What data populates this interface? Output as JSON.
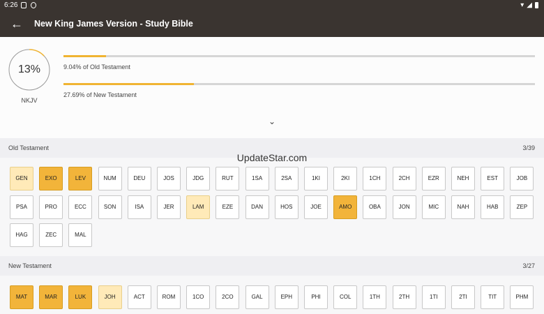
{
  "status_bar": {
    "time": "6:26"
  },
  "app_bar": {
    "title": "New King James Version - Study Bible"
  },
  "progress": {
    "overall_percent": "13%",
    "overall_fraction": 0.13,
    "version_label": "NKJV",
    "old_testament": {
      "caption": "9.04% of Old Testament",
      "fraction": 0.0904
    },
    "new_testament": {
      "caption": "27.69% of New Testament",
      "fraction": 0.2769
    }
  },
  "watermark": "UpdateStar.com",
  "old_testament": {
    "name": "Old Testament",
    "count": "3/39",
    "books": [
      {
        "code": "GEN",
        "status": "partial"
      },
      {
        "code": "EXO",
        "status": "done"
      },
      {
        "code": "LEV",
        "status": "done"
      },
      {
        "code": "NUM",
        "status": "none"
      },
      {
        "code": "DEU",
        "status": "none"
      },
      {
        "code": "JOS",
        "status": "none"
      },
      {
        "code": "JDG",
        "status": "none"
      },
      {
        "code": "RUT",
        "status": "none"
      },
      {
        "code": "1SA",
        "status": "none"
      },
      {
        "code": "2SA",
        "status": "none"
      },
      {
        "code": "1KI",
        "status": "none"
      },
      {
        "code": "2KI",
        "status": "none"
      },
      {
        "code": "1CH",
        "status": "none"
      },
      {
        "code": "2CH",
        "status": "none"
      },
      {
        "code": "EZR",
        "status": "none"
      },
      {
        "code": "NEH",
        "status": "none"
      },
      {
        "code": "EST",
        "status": "none"
      },
      {
        "code": "JOB",
        "status": "none"
      },
      {
        "code": "PSA",
        "status": "none"
      },
      {
        "code": "PRO",
        "status": "none"
      },
      {
        "code": "ECC",
        "status": "none"
      },
      {
        "code": "SON",
        "status": "none"
      },
      {
        "code": "ISA",
        "status": "none"
      },
      {
        "code": "JER",
        "status": "none"
      },
      {
        "code": "LAM",
        "status": "partial"
      },
      {
        "code": "EZE",
        "status": "none"
      },
      {
        "code": "DAN",
        "status": "none"
      },
      {
        "code": "HOS",
        "status": "none"
      },
      {
        "code": "JOE",
        "status": "none"
      },
      {
        "code": "AMO",
        "status": "done"
      },
      {
        "code": "OBA",
        "status": "none"
      },
      {
        "code": "JON",
        "status": "none"
      },
      {
        "code": "MIC",
        "status": "none"
      },
      {
        "code": "NAH",
        "status": "none"
      },
      {
        "code": "HAB",
        "status": "none"
      },
      {
        "code": "ZEP",
        "status": "none"
      },
      {
        "code": "HAG",
        "status": "none"
      },
      {
        "code": "ZEC",
        "status": "none"
      },
      {
        "code": "MAL",
        "status": "none"
      }
    ]
  },
  "new_testament": {
    "name": "New Testament",
    "count": "3/27",
    "books": [
      {
        "code": "MAT",
        "status": "done"
      },
      {
        "code": "MAR",
        "status": "done"
      },
      {
        "code": "LUK",
        "status": "done"
      },
      {
        "code": "JOH",
        "status": "partial"
      },
      {
        "code": "ACT",
        "status": "none"
      },
      {
        "code": "ROM",
        "status": "none"
      },
      {
        "code": "1CO",
        "status": "none"
      },
      {
        "code": "2CO",
        "status": "none"
      },
      {
        "code": "GAL",
        "status": "none"
      },
      {
        "code": "EPH",
        "status": "none"
      },
      {
        "code": "PHI",
        "status": "none"
      },
      {
        "code": "COL",
        "status": "none"
      },
      {
        "code": "1TH",
        "status": "none"
      },
      {
        "code": "2TH",
        "status": "none"
      },
      {
        "code": "1TI",
        "status": "none"
      },
      {
        "code": "2TI",
        "status": "none"
      },
      {
        "code": "TIT",
        "status": "none"
      },
      {
        "code": "PHM",
        "status": "none"
      }
    ]
  },
  "colors": {
    "accent": "#f2b43a",
    "partial": "#ffeab8",
    "appbar": "#3a3430"
  }
}
